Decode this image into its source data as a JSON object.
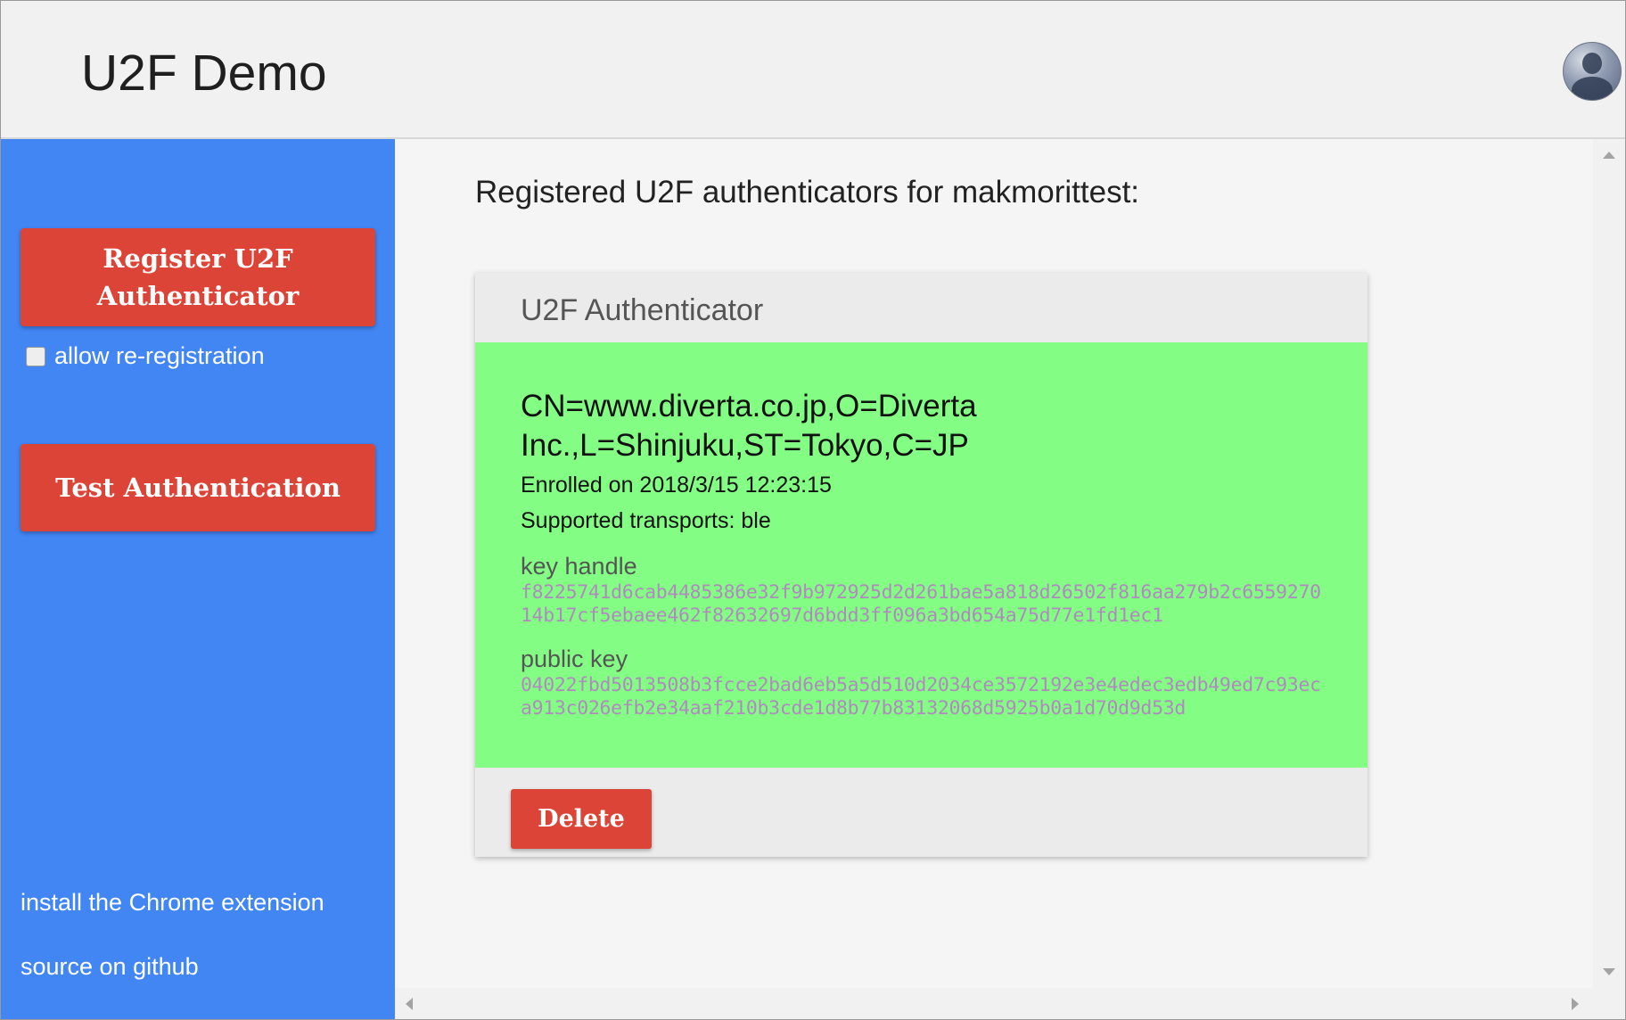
{
  "app": {
    "title": "U2F Demo"
  },
  "sidebar": {
    "register_label": "Register U2F Authenticator",
    "allow_reregistration_label": "allow re-registration",
    "allow_reregistration_checked": false,
    "test_label": "Test Authentication",
    "links": {
      "install_extension": "install the Chrome extension",
      "source": "source on github"
    }
  },
  "main": {
    "heading": "Registered U2F authenticators for makmorittest:",
    "card": {
      "title": "U2F Authenticator",
      "subject": "CN=www.diverta.co.jp,O=Diverta Inc.,L=Shinjuku,ST=Tokyo,C=JP",
      "enrolled": "Enrolled on 2018/3/15 12:23:15",
      "transports": "Supported transports: ble",
      "key_handle_label": "key handle",
      "key_handle": "f8225741d6cab4485386e32f9b972925d2d261bae5a818d26502f816aa279b2c655927014b17cf5ebaee462f82632697d6bdd3ff096a3bd654a75d77e1fd1ec1",
      "public_key_label": "public key",
      "public_key": "04022fbd5013508b3fcce2bad6eb5a5d510d2034ce3572192e3e4edec3edb49ed7c93eca913c026efb2e34aaf210b3cde1d8b77b83132068d5925b0a1d70d9d53d",
      "delete_label": "Delete"
    }
  },
  "colors": {
    "sidebar_bg": "#4286f4",
    "button_red": "#db4437",
    "card_body_green": "#84fd84",
    "hex_text": "#b08abf"
  },
  "icons": {
    "avatar": "user-avatar-icon",
    "scroll_up": "arrow-up-icon",
    "scroll_down": "arrow-down-icon",
    "scroll_left": "arrow-left-icon",
    "scroll_right": "arrow-right-icon"
  }
}
